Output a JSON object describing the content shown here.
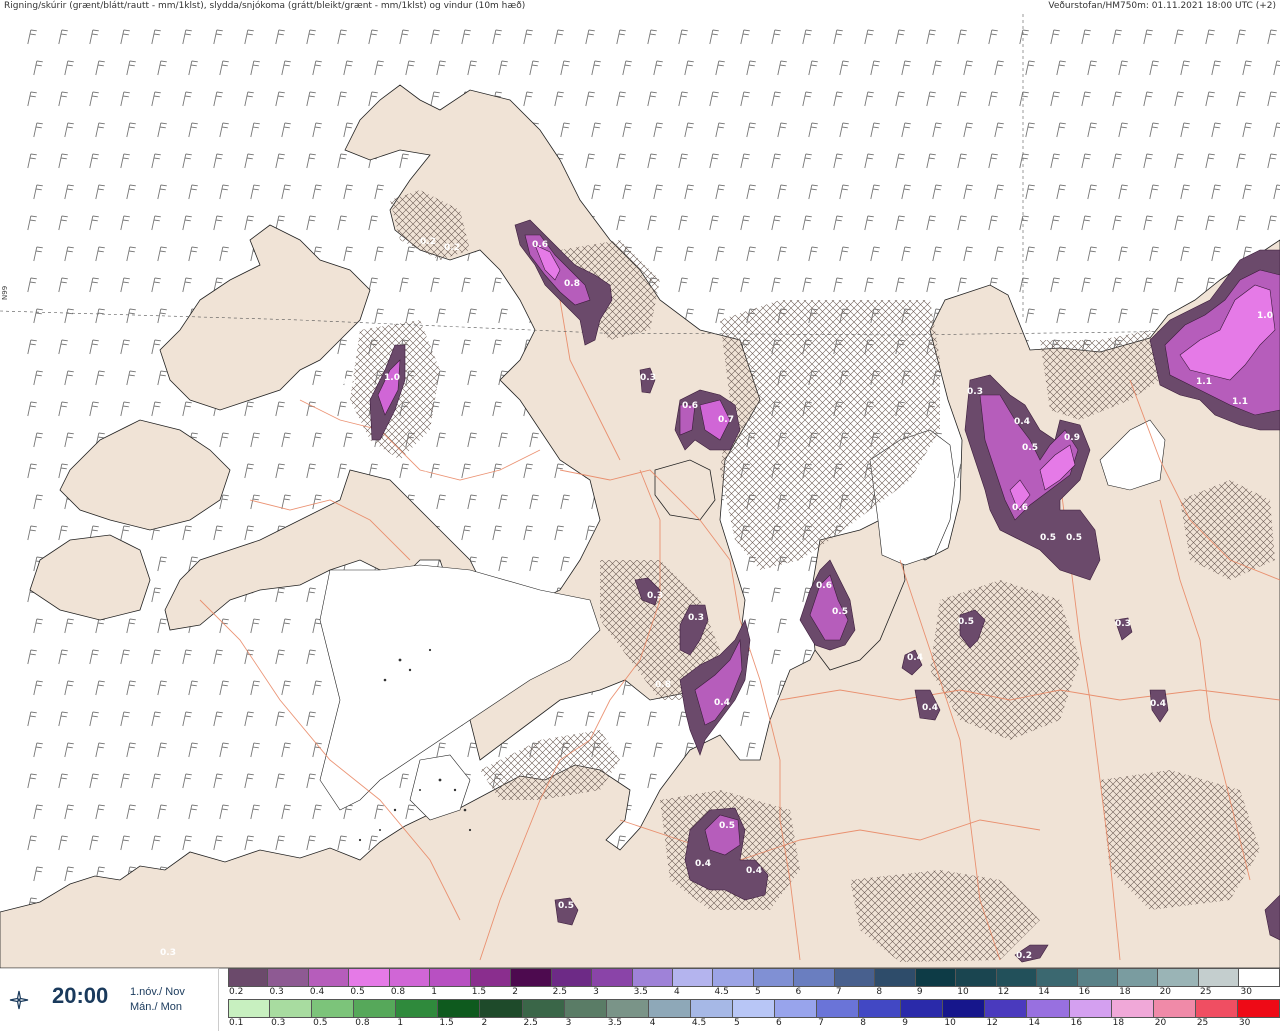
{
  "header": {
    "title": "Rigning/skúrir (grænt/blátt/rautt - mm/1klst), slydda/snjókoma (grátt/bleikt/grænt - mm/1klst) og vindur (10m hæð)",
    "source": "Veðurstofan/HM750m: 01.11.2021 18:00 UTC (+2)",
    "lat_label": "N99"
  },
  "time_panel": {
    "icon": "compass-star-icon",
    "time": "20:00",
    "date_is": "1.nóv./ Nov",
    "day": "Mán./ Mon"
  },
  "legend": {
    "snow_ticks": [
      "0.2",
      "0.3",
      "0.4",
      "0.5",
      "0.8",
      "1",
      "1.5",
      "2",
      "2.5",
      "3",
      "3.5",
      "4",
      "4.5",
      "5",
      "6",
      "7",
      "8",
      "9",
      "10",
      "12",
      "14",
      "16",
      "18",
      "20",
      "25",
      "30"
    ],
    "snow_colors": [
      "#6b4a6b",
      "#8e5a93",
      "#b65dbb",
      "#e57ae7",
      "#d066d6",
      "#b850c2",
      "#8a2e8e",
      "#4d0a4f",
      "#6d2a86",
      "#8a44a8",
      "#9f82d8",
      "#b4b4ee",
      "#9ca4e6",
      "#8090d4",
      "#6a7ec0",
      "#48608e",
      "#2e4c6a",
      "#0d3b46",
      "#1a4550",
      "#22505a",
      "#3b6870",
      "#5a8288",
      "#7a9ca0",
      "#9ab4b6",
      "#c4cece",
      "#ffffff"
    ],
    "rain_ticks": [
      "0.1",
      "0.3",
      "0.5",
      "0.8",
      "1",
      "1.5",
      "2",
      "2.5",
      "3",
      "3.5",
      "4",
      "4.5",
      "5",
      "6",
      "7",
      "8",
      "9",
      "10",
      "12",
      "14",
      "16",
      "18",
      "20",
      "25",
      "30"
    ],
    "rain_colors": [
      "#c8f0c0",
      "#a8dca0",
      "#7cc47a",
      "#56a85a",
      "#2f8a3c",
      "#0e5a1e",
      "#1e4a2a",
      "#3a6648",
      "#5a7c66",
      "#7a9488",
      "#8ea8b8",
      "#a6b8e6",
      "#b8c6f6",
      "#98a4ec",
      "#6a74d8",
      "#4248c4",
      "#2a2aaa",
      "#16168c",
      "#4a3abe",
      "#9870e0",
      "#d4a0f0",
      "#f0a8d8",
      "#f08aa8",
      "#f04e62",
      "#ee0a16"
    ]
  },
  "map": {
    "precip_labels": [
      "0.6",
      "0.8",
      "0.2",
      "0.2",
      "0.5",
      "1.0",
      "0.3",
      "0.6",
      "0.7",
      "0.2",
      "0.3",
      "0.3",
      "0.4",
      "0.5",
      "0.9",
      "0.6",
      "0.5",
      "0.5",
      "1.0",
      "1.1",
      "1.1",
      "0.6",
      "0.5",
      "0.3",
      "0.3",
      "0.8",
      "0.4",
      "0.5",
      "0.4",
      "0.4",
      "0.4",
      "0.3",
      "0.5",
      "0.4",
      "0.4",
      "0.2",
      "0.3",
      "0.5"
    ]
  }
}
